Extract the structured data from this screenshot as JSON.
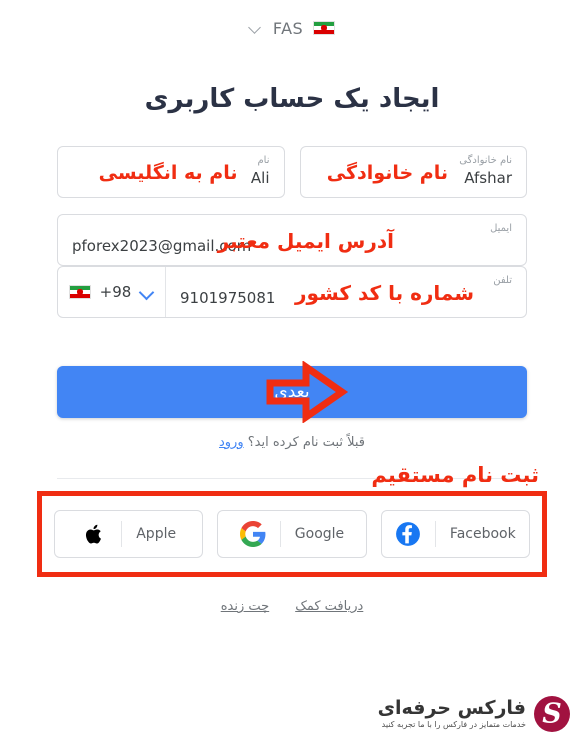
{
  "language_bar": {
    "code": "FAS",
    "flag_name": "iran-flag",
    "chevron_name": "chevron-down-icon"
  },
  "page_title": "ایجاد یک حساب کاربری",
  "form": {
    "last_name": {
      "label": "نام خانوادگی",
      "value": "Afshar",
      "annotation": "نام خانوادگی"
    },
    "first_name": {
      "label": "نام",
      "value": "Ali",
      "annotation": "نام به انگلیسی"
    },
    "email": {
      "label": "ایمیل",
      "value": "pforex2023@gmail.com",
      "annotation": "آدرس ایمیل معتبر"
    },
    "phone": {
      "label": "تلفن",
      "value": "9101975081",
      "country_code": "+98",
      "annotation": "شماره با کد کشور"
    }
  },
  "submit": {
    "label": "بعدی",
    "arrow_annotation": "arrow-right-annotation"
  },
  "login_prompt": {
    "text": "قبلاً ثبت نام کرده اید؟ ",
    "link": "ورود"
  },
  "social": {
    "annotation": "ثبت نام مستقیم",
    "buttons": [
      {
        "label": "Apple",
        "icon": "apple-icon"
      },
      {
        "label": "Google",
        "icon": "google-icon"
      },
      {
        "label": "Facebook",
        "icon": "facebook-icon"
      }
    ]
  },
  "footer_links": [
    {
      "label": "دریافت کمک"
    },
    {
      "label": "چت زنده"
    }
  ],
  "watermark": {
    "title": "فارکس حرفه‌ای",
    "subtitle": "خدمات متمایز در فارکس را با ما تجربه کنید"
  },
  "colors": {
    "primary": "#4285f4",
    "annotation_red": "#f02d12",
    "text": "#3c4043",
    "muted": "#9aa0a6",
    "watermark": "#9e0b3a"
  }
}
